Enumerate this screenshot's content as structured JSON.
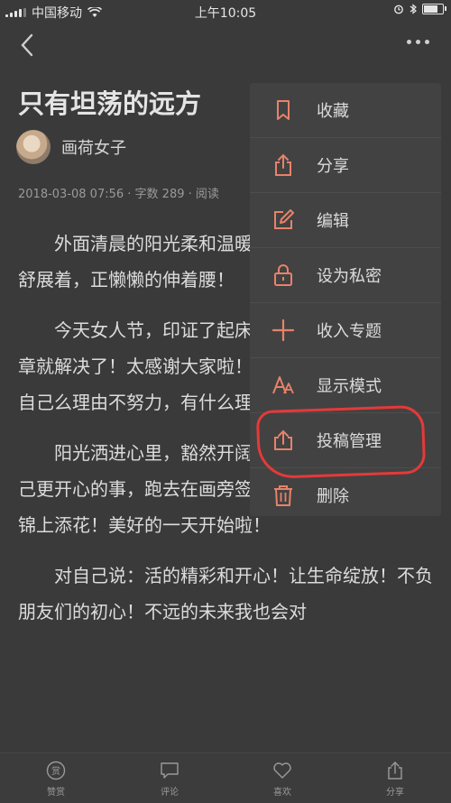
{
  "status": {
    "carrier": "中国移动",
    "time": "上午10:05",
    "battery_level": 0.85
  },
  "article": {
    "title": "只有坦荡的远方",
    "author": "画荷女子",
    "meta": "2018-03-08 07:56 · 字数 289 · 阅读",
    "paragraphs": [
      "外面清晨的阳光柔和温暖，来！并着微笑在脸上舒展着，正懒懒的伸着腰！",
      "今天女人节，印证了起床收到好多红包！昨天盖章就解决了！太感谢大家啦！的，几乎都是朋友在为自己么理由不努力，有什么理由",
      "阳光洒进心里，豁然开阔，灵光一闪，寻找让自己更开心的事，跑去在画旁签上自己的名字！呵呵！锦上添花！美好的一天开始啦！",
      "对自己说：活的精彩和开心！让生命绽放！不负朋友们的初心！不远的未来我也会对"
    ]
  },
  "menu": {
    "items": [
      {
        "label": "收藏",
        "icon": "bookmark-icon"
      },
      {
        "label": "分享",
        "icon": "share-icon"
      },
      {
        "label": "编辑",
        "icon": "edit-icon"
      },
      {
        "label": "设为私密",
        "icon": "lock-icon"
      },
      {
        "label": "收入专题",
        "icon": "plus-icon"
      },
      {
        "label": "显示模式",
        "icon": "font-size-icon"
      },
      {
        "label": "投稿管理",
        "icon": "upload-icon"
      },
      {
        "label": "删除",
        "icon": "trash-icon"
      }
    ],
    "accent_color": "#e8826a"
  },
  "tabbar": {
    "items": [
      {
        "label": "赞赏",
        "icon": "reward-icon",
        "glyph": "赏"
      },
      {
        "label": "评论",
        "icon": "comment-icon"
      },
      {
        "label": "喜欢",
        "icon": "heart-icon"
      },
      {
        "label": "分享",
        "icon": "share-icon"
      }
    ]
  }
}
